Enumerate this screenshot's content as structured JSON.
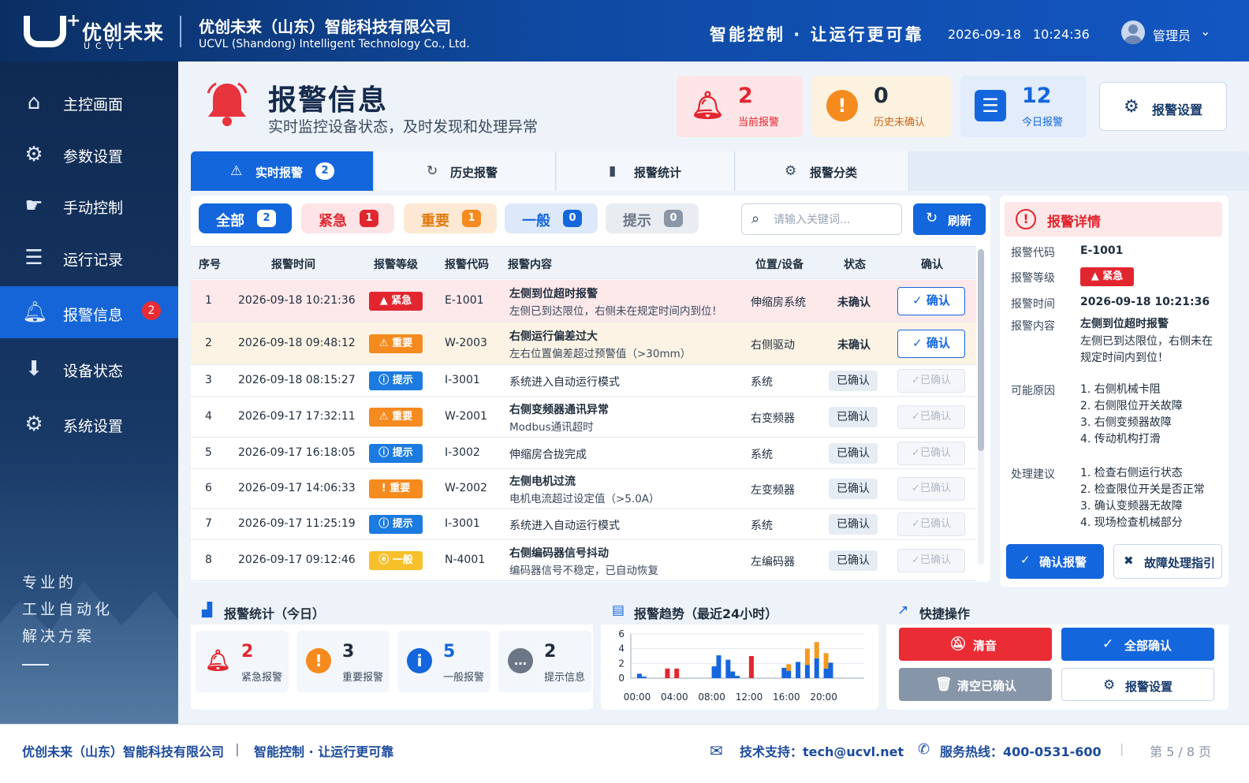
{
  "header": {
    "logo_cn": "优创未来",
    "logo_en": "UCVL",
    "company_cn": "优创未来（山东）智能科技有限公司",
    "company_en": "UCVL (Shandong) Intelligent Technology Co., Ltd.",
    "slogan": "智能控制 · 让运行更可靠",
    "date": "2026-09-18",
    "time": "10:24:36",
    "user": "管理员"
  },
  "sidebar": {
    "items": [
      {
        "label": "主控画面",
        "icon": "home-icon"
      },
      {
        "label": "参数设置",
        "icon": "gear-icon"
      },
      {
        "label": "手动控制",
        "icon": "hand-icon"
      },
      {
        "label": "运行记录",
        "icon": "log-icon"
      },
      {
        "label": "报警信息",
        "icon": "bell-icon",
        "badge": "2",
        "active": true
      },
      {
        "label": "设备状态",
        "icon": "download-icon"
      },
      {
        "label": "系统设置",
        "icon": "gear-icon"
      }
    ],
    "motto": [
      "专业的",
      "工业自动化",
      "解决方案"
    ]
  },
  "page": {
    "title": "报警信息",
    "subtitle": "实时监控设备状态，及时发现和处理异常"
  },
  "stats": {
    "current": {
      "value": "2",
      "label": "当前报警"
    },
    "unconfirmed": {
      "value": "0",
      "label": "历史未确认"
    },
    "today": {
      "value": "12",
      "label": "今日报警"
    },
    "settings_label": "报警设置"
  },
  "tabs": [
    {
      "label": "实时报警",
      "badge": "2"
    },
    {
      "label": "历史报警"
    },
    {
      "label": "报警统计"
    },
    {
      "label": "报警分类"
    }
  ],
  "filters": [
    {
      "label": "全部",
      "count": "2"
    },
    {
      "label": "紧急",
      "count": "1"
    },
    {
      "label": "重要",
      "count": "1"
    },
    {
      "label": "一般",
      "count": "0"
    },
    {
      "label": "提示",
      "count": "0"
    }
  ],
  "search": {
    "placeholder": "请输入关键词..."
  },
  "refresh_label": "刷新",
  "table": {
    "headers": [
      "序号",
      "报警时间",
      "报警等级",
      "报警代码",
      "报警内容",
      "位置/设备",
      "状态",
      "确认"
    ],
    "rows": [
      {
        "no": "1",
        "time": "2026-09-18 10:21:36",
        "level": "紧急",
        "level_icon": "▲",
        "code": "E-1001",
        "title": "左侧到位超时报警",
        "desc": "左侧已到达限位，右侧未在规定时间内到位！",
        "location": "伸缩房系统",
        "status": "未确认",
        "action": "确认"
      },
      {
        "no": "2",
        "time": "2026-09-18 09:48:12",
        "level": "重要",
        "level_icon": "⚠",
        "code": "W-2003",
        "title": "右侧运行偏差过大",
        "desc": "左右位置偏差超过预警值（>30mm）",
        "location": "右侧驱动",
        "status": "未确认",
        "action": "确认"
      },
      {
        "no": "3",
        "time": "2026-09-18 08:15:27",
        "level": "提示",
        "level_icon": "ⓘ",
        "code": "I-3001",
        "title": "系统进入自动运行模式",
        "desc": "",
        "location": "系统",
        "status": "已确认",
        "action": "✓已确认"
      },
      {
        "no": "4",
        "time": "2026-09-17 17:32:11",
        "level": "重要",
        "level_icon": "⚠",
        "code": "W-2001",
        "title": "右侧变频器通讯异常",
        "desc": "Modbus通讯超时",
        "location": "右变频器",
        "status": "已确认",
        "action": "✓已确认"
      },
      {
        "no": "5",
        "time": "2026-09-17 16:18:05",
        "level": "提示",
        "level_icon": "ⓘ",
        "code": "I-3002",
        "title": "伸缩房合拢完成",
        "desc": "",
        "location": "系统",
        "status": "已确认",
        "action": "✓已确认"
      },
      {
        "no": "6",
        "time": "2026-09-17 14:06:33",
        "level": "重要",
        "level_icon": "!",
        "code": "W-2002",
        "title": "左侧电机过流",
        "desc": "电机电流超过设定值（>5.0A）",
        "location": "左变频器",
        "status": "已确认",
        "action": "✓已确认"
      },
      {
        "no": "7",
        "time": "2026-09-17 11:25:19",
        "level": "提示",
        "level_icon": "ⓘ",
        "code": "I-3001",
        "title": "系统进入自动运行模式",
        "desc": "",
        "location": "系统",
        "status": "已确认",
        "action": "✓已确认"
      },
      {
        "no": "8",
        "time": "2026-09-17 09:12:46",
        "level": "一般",
        "level_icon": "ⓔ",
        "code": "N-4001",
        "title": "右侧编码器信号抖动",
        "desc": "编码器信号不稳定，已自动恢复",
        "location": "左编码器",
        "status": "已确认",
        "action": "✓已确认"
      }
    ],
    "scroll_fraction": 0.64
  },
  "detail": {
    "title": "报警详情",
    "code_label": "报警代码",
    "code": "E-1001",
    "level_label": "报警等级",
    "level": "紧急",
    "time_label": "报警时间",
    "time": "2026-09-18 10:21:36",
    "content_label": "报警内容",
    "content_title": "左侧到位超时报警",
    "content_desc": "左侧已到达限位，右侧未在规定时间内到位！",
    "causes_label": "可能原因",
    "causes": [
      "1. 右侧机械卡阻",
      "2. 右侧限位开关故障",
      "3. 右侧变频器故障",
      "4. 传动机构打滑"
    ],
    "advice_label": "处理建议",
    "advice": [
      "1. 检查右侧运行状态",
      "2. 检查限位开关是否正常",
      "3. 确认变频器无故障",
      "4. 现场检查机械部分"
    ],
    "confirm_label": "确认报警",
    "guide_label": "故障处理指引"
  },
  "today_stats": {
    "title": "报警统计（今日）",
    "items": [
      {
        "value": "2",
        "label": "紧急报警"
      },
      {
        "value": "3",
        "label": "重要报警"
      },
      {
        "value": "5",
        "label": "一般报警"
      },
      {
        "value": "2",
        "label": "提示信息"
      }
    ]
  },
  "trend": {
    "title": "报警趋势（最近24小时）"
  },
  "chart_data": {
    "type": "bar",
    "title": "报警趋势（最近24小时）",
    "y_ticks": [
      "6",
      "4",
      "2",
      "0"
    ],
    "x_ticks": [
      "00:00",
      "04:00",
      "08:00",
      "12:00",
      "16:00",
      "20:00"
    ],
    "ylim": [
      0,
      6
    ],
    "x": [
      0.5,
      1,
      3.5,
      4.5,
      8.5,
      9,
      10,
      10.5,
      11,
      12.5,
      14.5,
      15,
      16,
      16.5,
      17.5,
      18.5,
      19.5,
      20.5,
      21
    ],
    "series": [
      {
        "color": "#1466dd",
        "values": [
          0.6,
          0.2,
          0,
          0,
          1.6,
          3.1,
          2.5,
          0.9,
          0.3,
          0,
          0,
          0,
          1.4,
          1.0,
          2.2,
          1.8,
          2.7,
          1.3,
          2.1
        ]
      },
      {
        "color": "#e2262f",
        "values": [
          0,
          0,
          1.3,
          1.3,
          0,
          0,
          0,
          0,
          0,
          3.0,
          0,
          0,
          0,
          0,
          0,
          0,
          0,
          0,
          0
        ]
      },
      {
        "color": "#f39a1e",
        "values": [
          0,
          0,
          0,
          0,
          0,
          0,
          0,
          0,
          0,
          0,
          0,
          0,
          0,
          0.9,
          0,
          2.2,
          2.2,
          2.1,
          0
        ]
      }
    ]
  },
  "quick": {
    "title": "快捷操作",
    "mute": "清音",
    "confirm_all": "全部确认",
    "clear": "清空已确认",
    "settings": "报警设置"
  },
  "footer": {
    "company": "优创未来（山东）智能科技有限公司",
    "sep": "|",
    "slogan": "智能控制 · 让运行更可靠",
    "support": "技术支持：tech@ucvl.net",
    "hotline": "服务热线：400-0531-600",
    "sep2": "|",
    "page": "第 5 / 8 页"
  },
  "colors": {
    "primary": "#1466dd",
    "urgent": "#e2262f",
    "important": "#f58a1e",
    "hint": "#1b7be0",
    "general": "#f7c02b"
  }
}
